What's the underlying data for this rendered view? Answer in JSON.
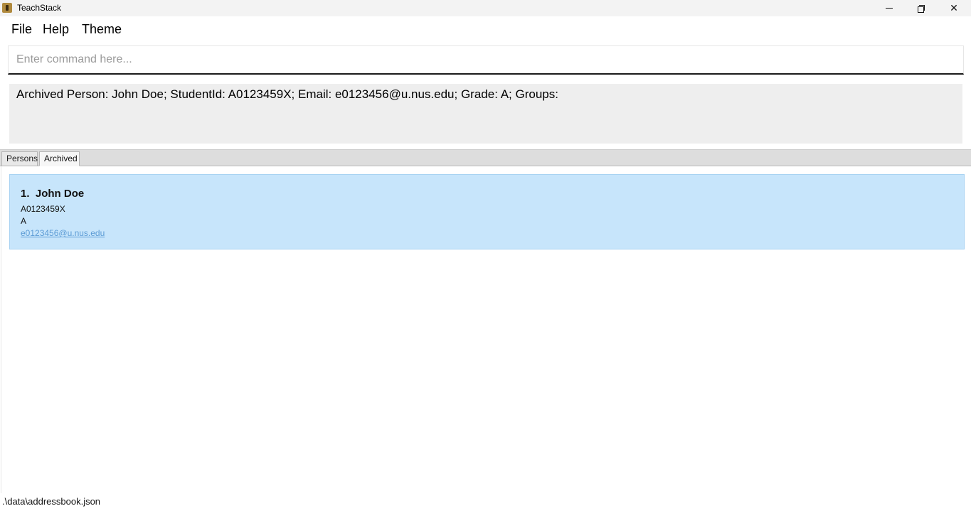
{
  "window": {
    "title": "TeachStack",
    "controls": {
      "minimize": "minimize-icon",
      "restore": "restore-icon",
      "close": "close-icon",
      "close_glyph": "✕"
    }
  },
  "menu": {
    "file": "File",
    "help": "Help",
    "theme": "Theme"
  },
  "command": {
    "placeholder": "Enter command here...",
    "value": ""
  },
  "result": {
    "text": "Archived Person: John Doe; StudentId: A0123459X; Email: e0123456@u.nus.edu; Grade: A; Groups: "
  },
  "tabs": [
    {
      "label": "Persons",
      "selected": false
    },
    {
      "label": "Archived",
      "selected": true
    }
  ],
  "list": {
    "items": [
      {
        "index": "1.",
        "name": "John Doe",
        "student_id": "A0123459X",
        "grade": "A",
        "email": "e0123456@u.nus.edu"
      }
    ]
  },
  "status": {
    "file_path": ".\\data\\addressbook.json"
  },
  "colors": {
    "card_background": "#c7e5fb",
    "result_background": "#eeeeee",
    "email_link": "#5b9bd5"
  }
}
